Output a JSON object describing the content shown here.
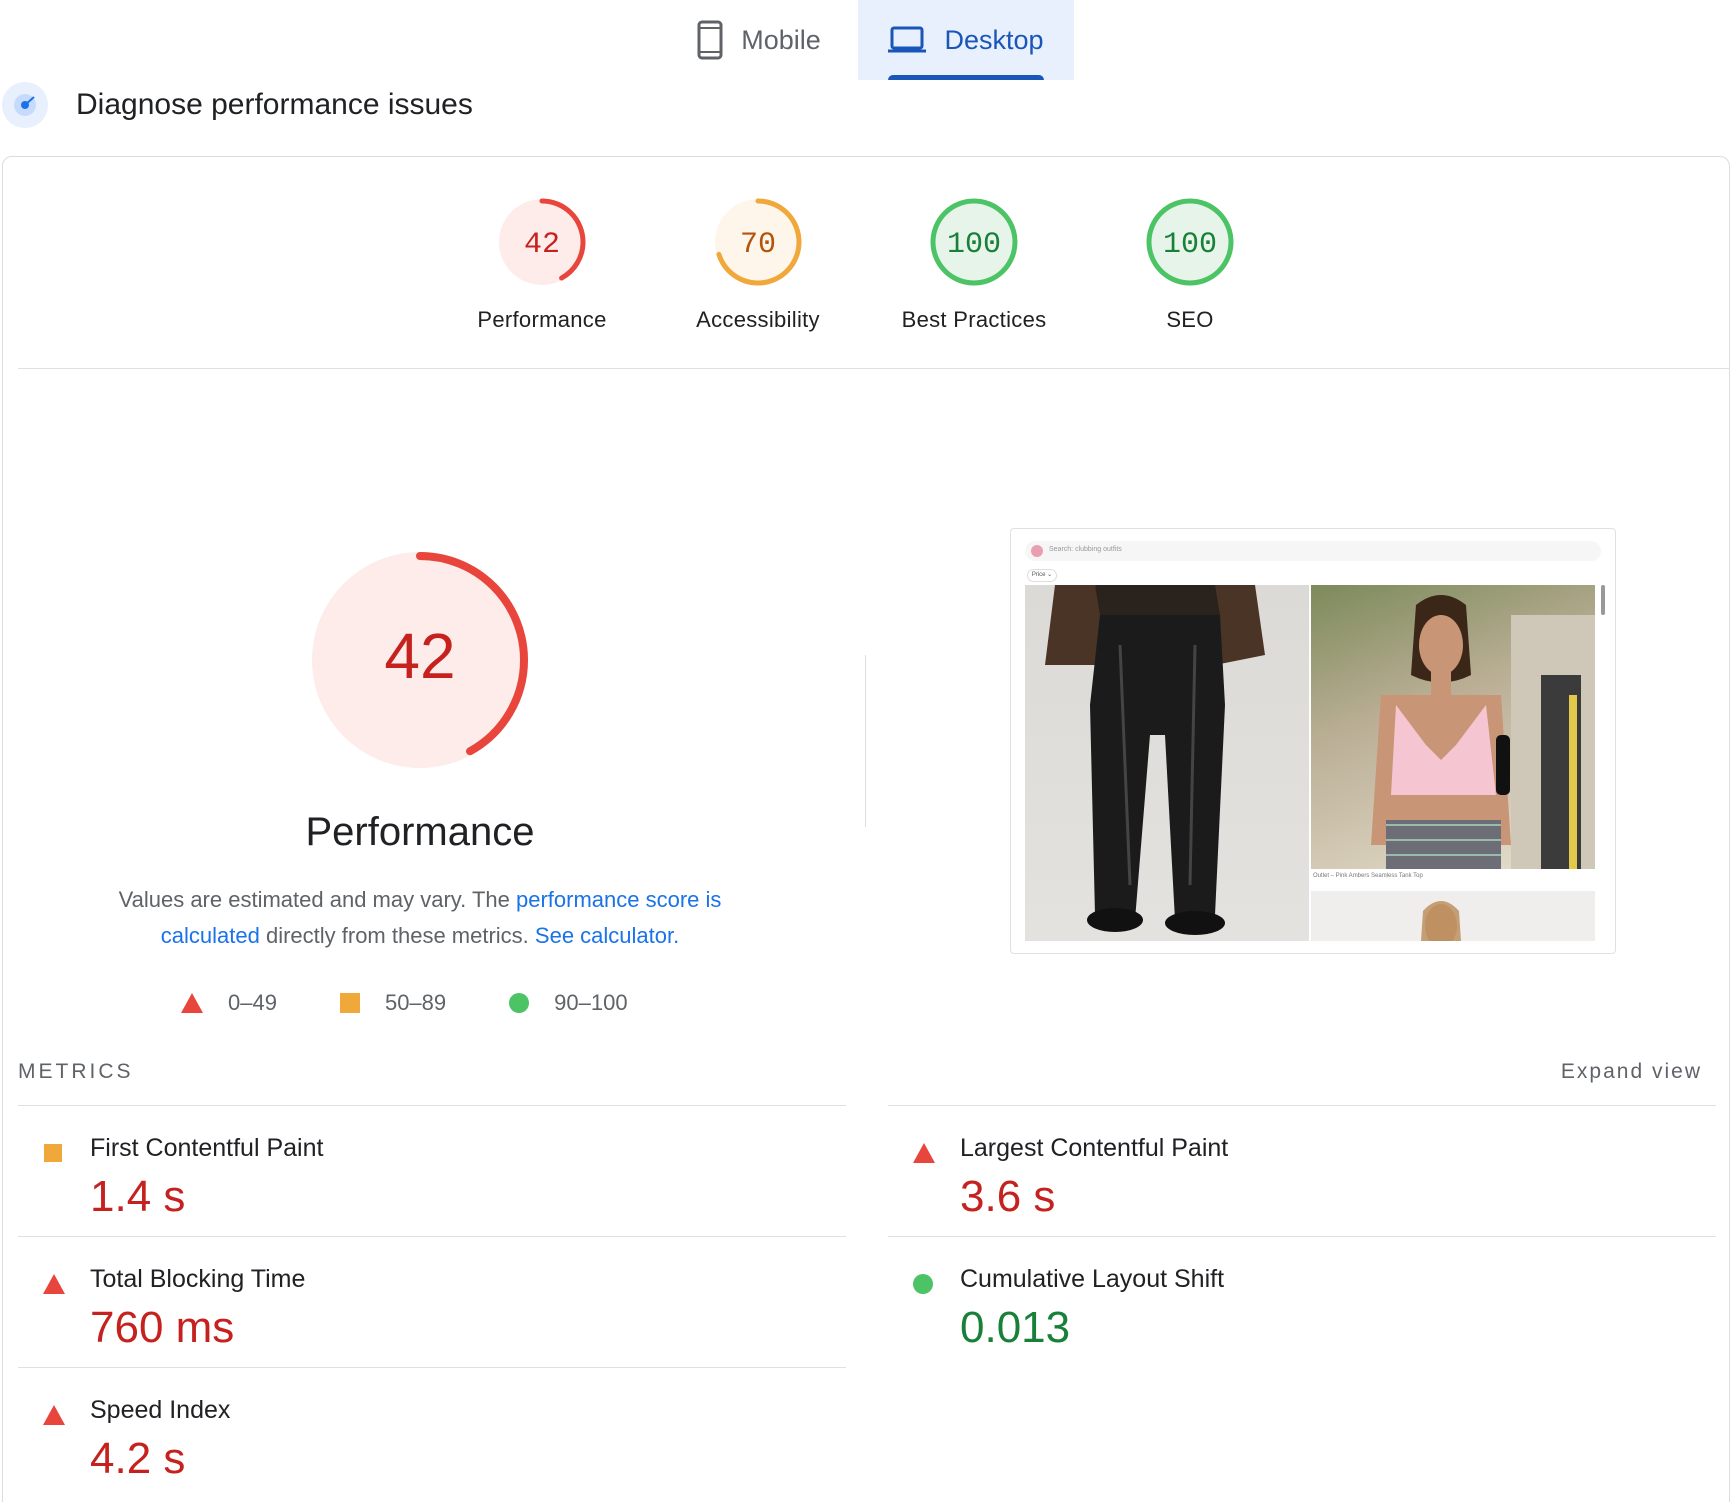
{
  "tabs": [
    {
      "label": "Mobile",
      "icon": "smartphone-icon",
      "active": false
    },
    {
      "label": "Desktop",
      "icon": "laptop-icon",
      "active": true
    }
  ],
  "section": {
    "title": "Diagnose performance issues",
    "icon": "diagnose-icon"
  },
  "scores": [
    {
      "label": "Performance",
      "score": "42",
      "value": 42,
      "rating": "fail",
      "color": "#e8453c"
    },
    {
      "label": "Accessibility",
      "score": "70",
      "value": 70,
      "rating": "average",
      "color": "#f0a83a"
    },
    {
      "label": "Best Practices",
      "score": "100",
      "value": 100,
      "rating": "pass",
      "color": "#4cc364"
    },
    {
      "label": "SEO",
      "score": "100",
      "value": 100,
      "rating": "pass",
      "color": "#4cc364"
    }
  ],
  "main_gauge": {
    "score": "42",
    "value": 42,
    "title": "Performance",
    "color": "#e8453c"
  },
  "description": {
    "text_before": "Values are estimated and may vary. The ",
    "link1": "performance score is calculated",
    "text_middle": " directly from these metrics. ",
    "link2": "See calculator."
  },
  "legend": [
    {
      "range": "0–49",
      "shape": "triangle",
      "color": "#e8453c"
    },
    {
      "range": "50–89",
      "shape": "square",
      "color": "#f0a83a"
    },
    {
      "range": "90–100",
      "shape": "circle",
      "color": "#4cc364"
    }
  ],
  "screenshot": {
    "search_text": "Search: clubbing outfits",
    "filter_chip": "Price ⌄",
    "caption": "Outlet – Pink Ambers Seamless Tank Top"
  },
  "metrics_header": {
    "label": "METRICS",
    "expand": "Expand view"
  },
  "metrics": [
    {
      "name": "First Contentful Paint",
      "value": "1.4 s",
      "rating": "average"
    },
    {
      "name": "Largest Contentful Paint",
      "value": "3.6 s",
      "rating": "fail"
    },
    {
      "name": "Total Blocking Time",
      "value": "760 ms",
      "rating": "fail"
    },
    {
      "name": "Cumulative Layout Shift",
      "value": "0.013",
      "rating": "pass"
    },
    {
      "name": "Speed Index",
      "value": "4.2 s",
      "rating": "fail"
    }
  ],
  "colors": {
    "fail": "#e8453c",
    "average": "#f0a83a",
    "pass": "#4cc364",
    "fail_text": "#c5221f",
    "pass_text": "#188038",
    "link": "#1a73e8",
    "active_tab": "#1a56b8"
  }
}
